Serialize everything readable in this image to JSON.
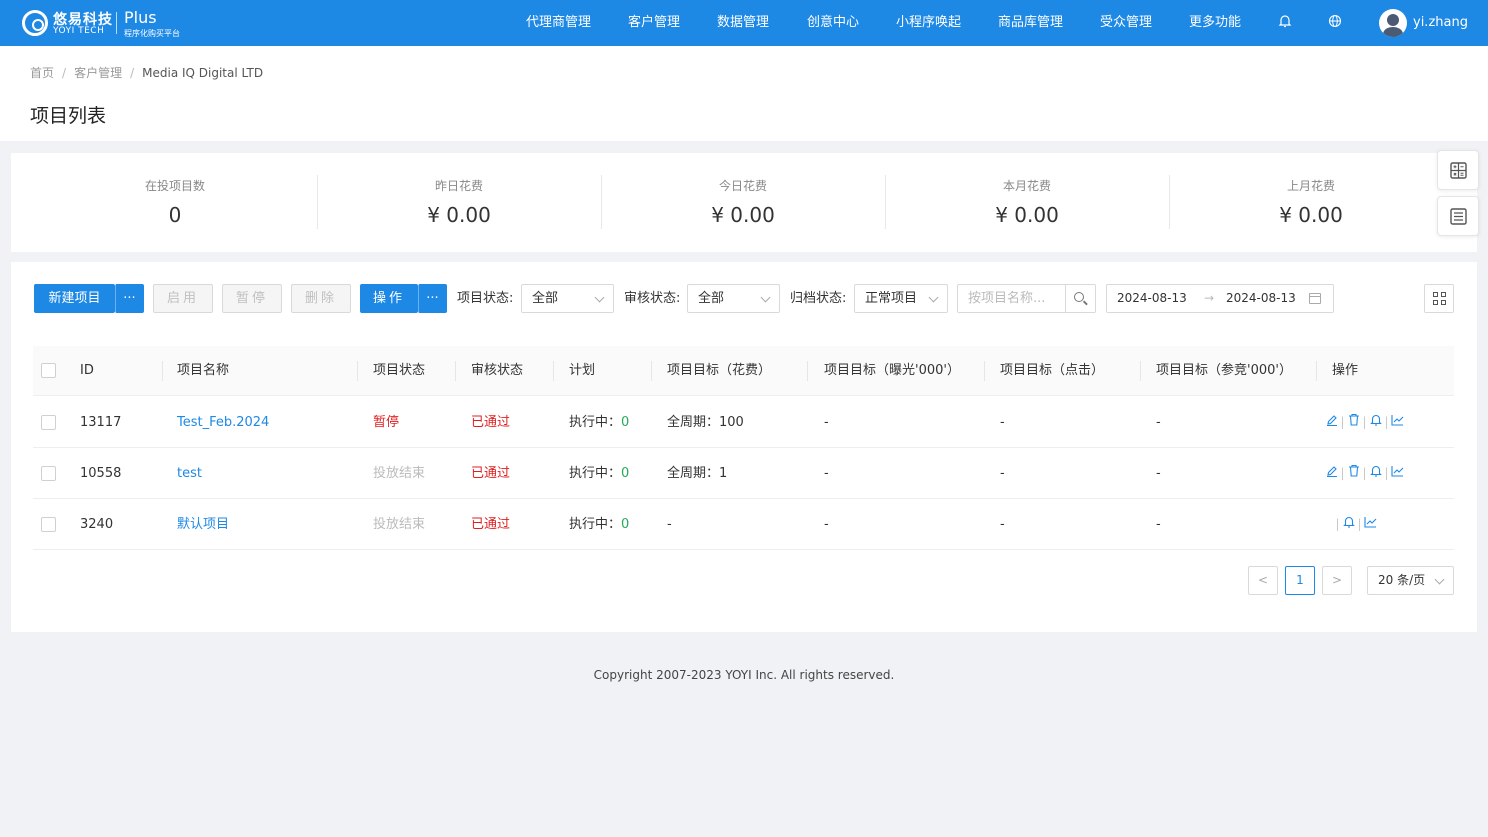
{
  "brand": {
    "cn": "悠易科技",
    "en": "YOYI TECH",
    "plus": "Plus",
    "sub": "程序化购买平台"
  },
  "nav": [
    "代理商管理",
    "客户管理",
    "数据管理",
    "创意中心",
    "小程序唤起",
    "商品库管理",
    "受众管理",
    "更多功能"
  ],
  "user": {
    "name": "yi.zhang"
  },
  "breadcrumb": {
    "home": "首页",
    "section": "客户管理",
    "current": "Media IQ Digital LTD",
    "separator": "/"
  },
  "page_title": "项目列表",
  "stats": [
    {
      "label": "在投项目数",
      "value": "0"
    },
    {
      "label": "昨日花费",
      "value": "¥ 0.00"
    },
    {
      "label": "今日花费",
      "value": "¥ 0.00"
    },
    {
      "label": "本月花费",
      "value": "¥ 0.00"
    },
    {
      "label": "上月花费",
      "value": "¥ 0.00"
    }
  ],
  "toolbar": {
    "new_project": "新建项目",
    "more": "···",
    "enable": "启用",
    "pause": "暂停",
    "delete": "删除",
    "operate": "操作",
    "project_status_label": "项目状态:",
    "project_status_value": "全部",
    "review_status_label": "审核状态:",
    "review_status_value": "全部",
    "archive_status_label": "归档状态:",
    "archive_status_value": "正常项目",
    "search_placeholder": "按项目名称...",
    "date_start": "2024-08-13",
    "date_arrow": "→",
    "date_end": "2024-08-13"
  },
  "table": {
    "headers": [
      "ID",
      "项目名称",
      "项目状态",
      "审核状态",
      "计划",
      "项目目标（花费）",
      "项目目标（曝光'000'）",
      "项目目标（点击）",
      "项目目标（参竞'000'）",
      "操作"
    ],
    "rows": [
      {
        "id": "13117",
        "name": "Test_Feb.2024",
        "status": "暂停",
        "review": "已通过",
        "plan_label": "执行中：",
        "plan_count": "0",
        "goal_cost": "全周期：100",
        "goal_imp": "-",
        "goal_click": "-",
        "goal_bid": "-"
      },
      {
        "id": "10558",
        "name": "test",
        "status": "投放结束",
        "review": "已通过",
        "plan_label": "执行中：",
        "plan_count": "0",
        "goal_cost": "全周期：1",
        "goal_imp": "-",
        "goal_click": "-",
        "goal_bid": "-"
      },
      {
        "id": "3240",
        "name": "默认项目",
        "status": "投放结束",
        "review": "已通过",
        "plan_label": "执行中：",
        "plan_count": "0",
        "goal_cost": "-",
        "goal_imp": "-",
        "goal_click": "-",
        "goal_bid": "-"
      }
    ]
  },
  "pagination": {
    "prev": "<",
    "current": "1",
    "next": ">",
    "page_size": "20 条/页"
  },
  "footer": "Copyright 2007-2023 YOYI Inc. All rights reserved.",
  "colors": {
    "primary": "#1e88e5",
    "danger": "#e02020",
    "success": "#2aa85a",
    "muted": "#bbbbbb"
  }
}
